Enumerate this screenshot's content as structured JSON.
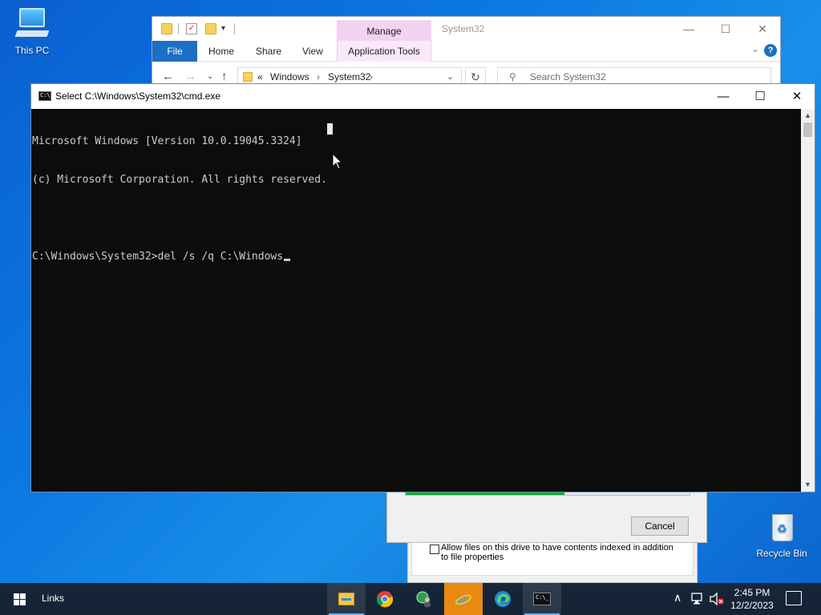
{
  "desktop": {
    "icons": [
      {
        "label": "This PC",
        "icon": "computer-icon"
      },
      {
        "label": "Recycle Bin",
        "icon": "recycle-bin-icon"
      }
    ]
  },
  "explorer": {
    "title": "System32",
    "contextual_tab": "Manage",
    "ribbon_tabs": [
      "File",
      "Home",
      "Share",
      "View",
      "Application Tools"
    ],
    "breadcrumb": [
      "Windows",
      "System32"
    ],
    "breadcrumb_prefix": "«",
    "search_placeholder": "Search System32",
    "help_label": "?",
    "controls": {
      "minimize": "—",
      "maximize": "☐",
      "close": "✕"
    }
  },
  "cmd": {
    "title": "Select C:\\Windows\\System32\\cmd.exe",
    "icon_text": "C:\\_",
    "lines": [
      "Microsoft Windows [Version 10.0.19045.3324]",
      "(c) Microsoft Corporation. All rights reserved.",
      "",
      "C:\\Windows\\System32>del /s /q C:\\Windows"
    ],
    "controls": {
      "minimize": "—",
      "maximize": "☐",
      "close": "✕"
    }
  },
  "background_dialog": {
    "cancel_label": "Cancel",
    "progress": 0.56,
    "progress_color": "#06b025"
  },
  "properties_window": {
    "checkbox_text": "Allow files on this drive to have contents indexed in addition to file properties",
    "checked": false
  },
  "taskbar": {
    "toolbar_label": "Links",
    "apps": [
      {
        "name": "file-explorer-icon",
        "active": true
      },
      {
        "name": "chrome-icon",
        "active": false
      },
      {
        "name": "network-user-icon",
        "active": false
      },
      {
        "name": "internet-explorer-icon",
        "active": false
      },
      {
        "name": "edge-icon",
        "active": false
      },
      {
        "name": "command-prompt-icon",
        "active": true
      }
    ],
    "time": "2:45 PM",
    "date": "12/2/2023"
  },
  "colors": {
    "desktop": "#0b78e3",
    "taskbar": "#18263a",
    "console_bg": "#0c0c0c",
    "console_text": "#cccccc",
    "ribbon_file": "#1b6fc4",
    "manage_tab": "#f2d3f2"
  }
}
